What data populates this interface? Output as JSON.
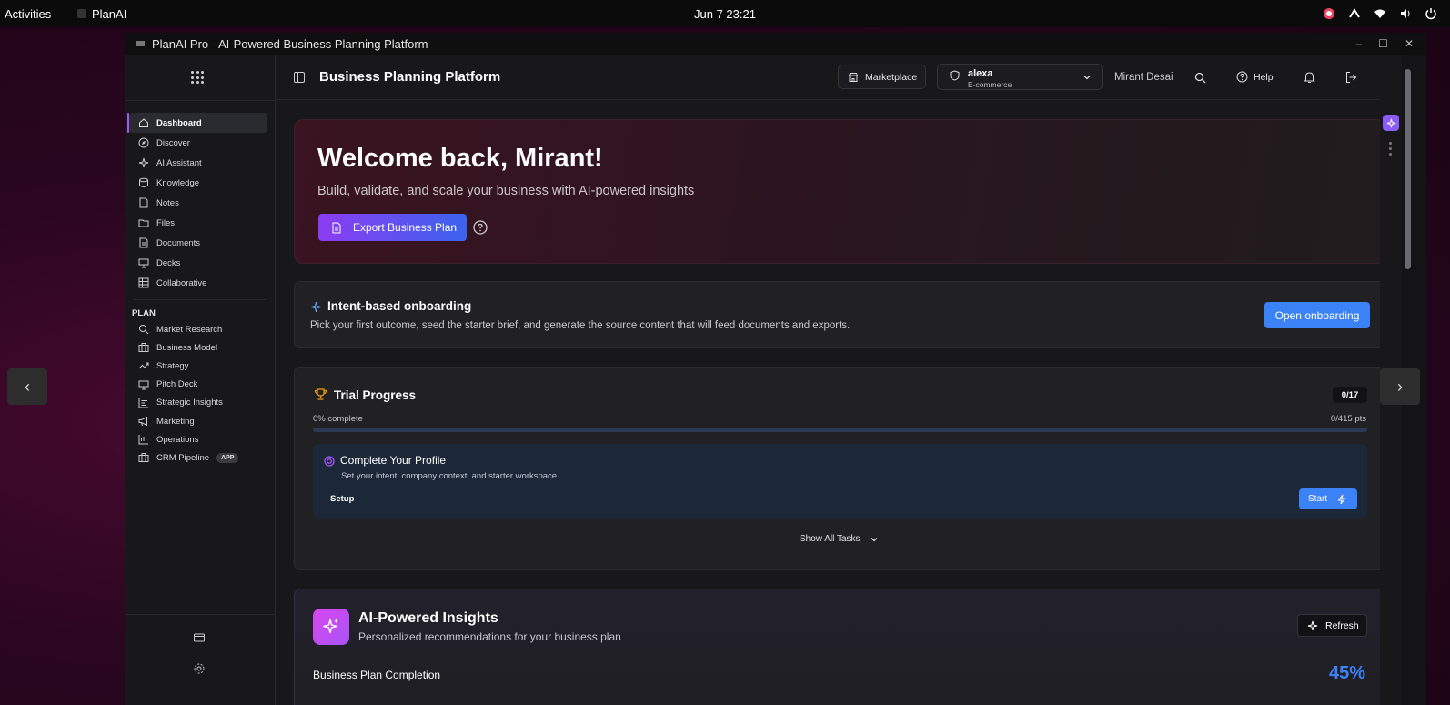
{
  "system": {
    "activities": "Activities",
    "app": "PlanAI",
    "clock": "Jun 7  23:21"
  },
  "window": {
    "title": "PlanAI Pro - AI-Powered Business Planning Platform"
  },
  "sidebar": {
    "items": [
      {
        "label": "Dashboard",
        "icon": "home-icon",
        "active": true
      },
      {
        "label": "Discover",
        "icon": "compass-icon"
      },
      {
        "label": "AI Assistant",
        "icon": "sparkles-icon"
      },
      {
        "label": "Knowledge",
        "icon": "database-icon"
      },
      {
        "label": "Notes",
        "icon": "note-icon"
      },
      {
        "label": "Files",
        "icon": "folder-icon"
      },
      {
        "label": "Documents",
        "icon": "document-icon"
      },
      {
        "label": "Decks",
        "icon": "presentation-icon"
      },
      {
        "label": "Collaborative",
        "icon": "table-icon"
      }
    ],
    "plan_heading": "PLAN",
    "plan_items": [
      {
        "label": "Market Research",
        "icon": "search-icon"
      },
      {
        "label": "Business Model",
        "icon": "briefcase-icon"
      },
      {
        "label": "Strategy",
        "icon": "trending-up-icon"
      },
      {
        "label": "Pitch Deck",
        "icon": "presentation-icon"
      },
      {
        "label": "Strategic Insights",
        "icon": "bar-chart-icon"
      },
      {
        "label": "Marketing",
        "icon": "megaphone-icon"
      },
      {
        "label": "Operations",
        "icon": "chart-icon"
      },
      {
        "label": "CRM Pipeline",
        "icon": "briefcase-icon",
        "badge": "APP"
      }
    ]
  },
  "header": {
    "title": "Business Planning Platform",
    "marketplace": "Marketplace",
    "business_name": "alexa",
    "business_type": "E-commerce",
    "user": "Mirant Desai",
    "help": "Help"
  },
  "hero": {
    "title": "Welcome back, Mirant!",
    "lead": "Build, validate, and scale your business with AI-powered insights",
    "export_label": "Export Business Plan"
  },
  "onboarding": {
    "title": "Intent-based onboarding",
    "description": "Pick your first outcome, seed the starter brief, and generate the source content that will feed documents and exports.",
    "button": "Open onboarding"
  },
  "trial": {
    "title": "Trial Progress",
    "count": "0/17",
    "percent_label": "0% complete",
    "progress": 0,
    "points": "0/415 pts",
    "task": {
      "title": "Complete Your Profile",
      "description": "Set your intent, company context, and starter workspace",
      "tag": "Setup",
      "button": "Start"
    },
    "show_all": "Show All Tasks"
  },
  "insights": {
    "title": "AI-Powered Insights",
    "subtitle": "Personalized recommendations for your business plan",
    "refresh": "Refresh",
    "completion_label": "Business Plan Completion",
    "completion_value": "45%"
  },
  "colors": {
    "accent_purple": "#a855f7",
    "accent_blue": "#3b82f6"
  }
}
